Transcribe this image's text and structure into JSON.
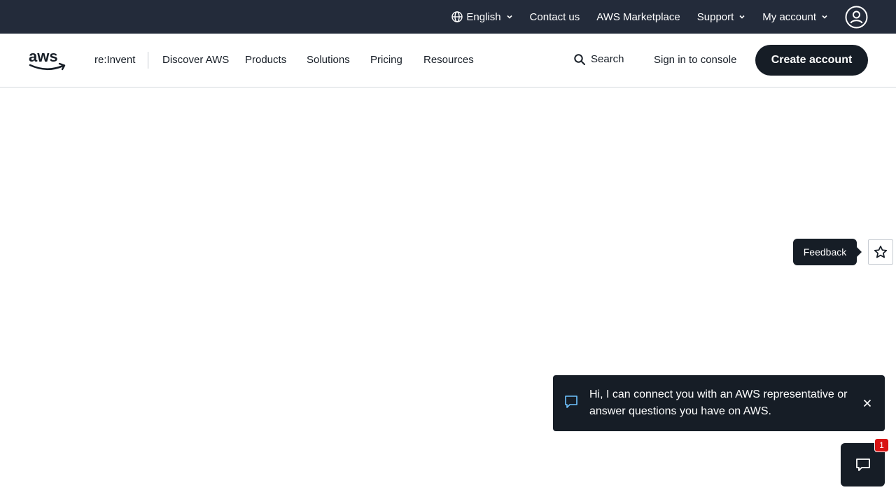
{
  "colors": {
    "topbar_bg": "#232b3a",
    "dark": "#161d26",
    "accent_chat": "#6fc3ff",
    "badge_red": "#d91515"
  },
  "utility_bar": {
    "language": {
      "label": "English",
      "icon": "globe-icon"
    },
    "contact": "Contact us",
    "marketplace": "AWS Marketplace",
    "support": "Support",
    "account": "My account",
    "account_icon": "user-circle-icon"
  },
  "main_nav": {
    "logo": "aws",
    "reinvent": "re:Invent",
    "items": [
      "Discover AWS",
      "Products",
      "Solutions",
      "Pricing",
      "Resources"
    ],
    "search": "Search",
    "sign_in": "Sign in to console",
    "create_account": "Create account"
  },
  "feedback": {
    "label": "Feedback",
    "icon": "star-icon"
  },
  "chat": {
    "message": "Hi, I can connect you with an AWS representative or answer questions you have on AWS.",
    "badge_count": "1",
    "icon": "chat-bubble-icon"
  }
}
